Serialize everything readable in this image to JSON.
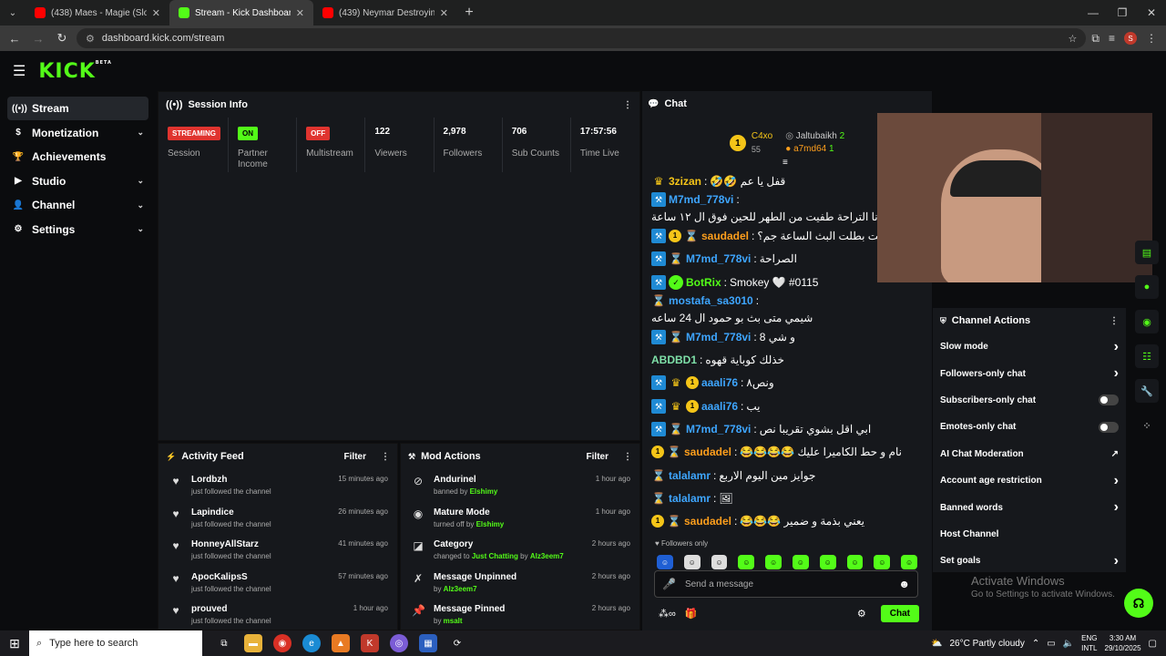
{
  "browser": {
    "tabs": [
      {
        "title": "(438) Maes - Magie (Slowed -",
        "color": "#ff0000"
      },
      {
        "title": "Stream - Kick Dashboard",
        "color": "#53fc18"
      },
      {
        "title": "(439) Neymar Destroying Baye",
        "color": "#ff0000"
      }
    ],
    "url": "dashboard.kick.com/stream",
    "profile_initial": "S"
  },
  "logo": "KICK",
  "logo_beta": "BETA",
  "sidebar": {
    "items": [
      {
        "label": "Stream",
        "icon": "radio-icon"
      },
      {
        "label": "Monetization",
        "icon": "dollar-icon"
      },
      {
        "label": "Achievements",
        "icon": "trophy-icon"
      },
      {
        "label": "Studio",
        "icon": "video-icon"
      },
      {
        "label": "Channel",
        "icon": "user-icon"
      },
      {
        "label": "Settings",
        "icon": "gear-icon"
      }
    ]
  },
  "session": {
    "title": "Session Info",
    "stats": [
      {
        "badge": "STREAMING",
        "caption": "Session"
      },
      {
        "badge": "ON",
        "caption": "Partner Income"
      },
      {
        "badge": "OFF",
        "caption": "Multistream"
      },
      {
        "num": "122",
        "caption": "Viewers"
      },
      {
        "num": "2,978",
        "caption": "Followers"
      },
      {
        "num": "706",
        "caption": "Sub Counts"
      },
      {
        "num": "17:57:56",
        "caption": "Time Live"
      }
    ]
  },
  "activity": {
    "title": "Activity Feed",
    "filter": "Filter",
    "rows": [
      {
        "name": "Lordbzh",
        "sub": "just followed the channel",
        "time": "15 minutes ago"
      },
      {
        "name": "Lapindice",
        "sub": "just followed the channel",
        "time": "26 minutes ago"
      },
      {
        "name": "HonneyAllStarz",
        "sub": "just followed the channel",
        "time": "41 minutes ago"
      },
      {
        "name": "ApocKalipsS",
        "sub": "just followed the channel",
        "time": "57 minutes ago"
      },
      {
        "name": "prouved",
        "sub": "just followed the channel",
        "time": "1 hour ago"
      }
    ]
  },
  "mod": {
    "title": "Mod Actions",
    "filter": "Filter",
    "rows": [
      {
        "name": "Andurinel",
        "pre": "banned by ",
        "by": "Elshimy",
        "time": "1 hour ago",
        "icon": "ban-icon"
      },
      {
        "name": "Mature Mode",
        "pre": "turned off by ",
        "by": "Elshimy",
        "time": "1 hour ago",
        "icon": "eye-icon"
      },
      {
        "name": "Category",
        "pre": "changed to ",
        "by": "Just Chatting",
        "mid": " by ",
        "by2": "Alz3eem7",
        "time": "2 hours ago",
        "icon": "tag-icon"
      },
      {
        "name": "Message Unpinned",
        "pre": "by ",
        "by": "Alz3eem7",
        "time": "2 hours ago",
        "icon": "unpin-icon"
      },
      {
        "name": "Message Pinned",
        "pre": "by ",
        "by": "msalt",
        "time": "2 hours ago",
        "icon": "pin-icon"
      }
    ]
  },
  "chat": {
    "title": "Chat",
    "leaders": [
      {
        "name": "C4xo",
        "count": "55"
      },
      {
        "name": "Jaltubaikh",
        "count": "2"
      },
      {
        "name": "a7md64",
        "count": "1"
      }
    ],
    "messages": [
      {
        "user": "3zizan",
        "color": "#f5c518",
        "badges": [
          "crown"
        ],
        "text": "قفل يا عم 🤣🤣"
      },
      {
        "user": "M7md_778vi",
        "color": "#3ea6ff",
        "badges": [
          "mod"
        ],
        "text": "انا التراحة طفيت من الطهر للحين فوق ال ١٢ ساعة"
      },
      {
        "user": "saudadel",
        "color": "#ff9f1c",
        "badges": [
          "mod",
          "coin",
          "sub"
        ],
        "text": "انت بطلت البث الساعة جم؟"
      },
      {
        "user": "M7md_778vi",
        "color": "#3ea6ff",
        "badges": [
          "mod",
          "sub"
        ],
        "text": "الصراحة"
      },
      {
        "user": "BotRix",
        "color": "#53fc18",
        "badges": [
          "mod",
          "ver"
        ],
        "text": "Smokey 🤍 #0115"
      },
      {
        "user": "mostafa_sa3010",
        "color": "#3ea6ff",
        "badges": [
          "sub"
        ],
        "text": "شيمي متى بث بو حمود ال 24 ساعه"
      },
      {
        "user": "M7md_778vi",
        "color": "#3ea6ff",
        "badges": [
          "mod",
          "sub"
        ],
        "text": "و شي 8"
      },
      {
        "user": "ABDBD1",
        "color": "#7ee0a8",
        "badges": [],
        "text": "خذلك كوباية قهوه"
      },
      {
        "user": "aaali76",
        "color": "#3ea6ff",
        "badges": [
          "mod",
          "crown",
          "coin"
        ],
        "text": "ونص٨"
      },
      {
        "user": "aaali76",
        "color": "#3ea6ff",
        "badges": [
          "mod",
          "crown",
          "coin"
        ],
        "text": "يب"
      },
      {
        "user": "M7md_778vi",
        "color": "#3ea6ff",
        "badges": [
          "mod",
          "sub"
        ],
        "text": "ابي اقل بشوي تقريبا نص"
      },
      {
        "user": "saudadel",
        "color": "#ff9f1c",
        "badges": [
          "coin",
          "sub"
        ],
        "text": "نام و حط الكاميرا عليك 😂😂😂😂"
      },
      {
        "user": "talalamr",
        "color": "#3ea6ff",
        "badges": [
          "sub"
        ],
        "text": "جوايز مين اليوم الاربع"
      },
      {
        "user": "talalamr",
        "color": "#3ea6ff",
        "badges": [
          "sub"
        ],
        "text": "🖼"
      },
      {
        "user": "saudadel",
        "color": "#ff9f1c",
        "badges": [
          "coin",
          "sub"
        ],
        "text": "يعني بذمة و ضمير 😂😂😂"
      }
    ],
    "followers_only": "Followers only",
    "placeholder": "Send a message",
    "send": "Chat",
    "coin_label": "1"
  },
  "actions": {
    "title": "Channel Actions",
    "items": [
      {
        "label": "Slow mode",
        "ctrl": "chevron"
      },
      {
        "label": "Followers-only chat",
        "ctrl": "chevron"
      },
      {
        "label": "Subscribers-only chat",
        "ctrl": "toggle"
      },
      {
        "label": "Emotes-only chat",
        "ctrl": "toggle"
      },
      {
        "label": "AI Chat Moderation",
        "ctrl": "external"
      },
      {
        "label": "Account age restriction",
        "ctrl": "chevron"
      },
      {
        "label": "Banned words",
        "ctrl": "chevron"
      },
      {
        "label": "Host Channel",
        "ctrl": "none"
      },
      {
        "label": "Set goals",
        "ctrl": "chevron"
      }
    ]
  },
  "watermark": {
    "line1": "Activate Windows",
    "line2": "Go to Settings to activate Windows."
  },
  "taskbar": {
    "search": "Type here to search",
    "weather": "26°C  Partly cloudy",
    "lang": "ENG",
    "lang2": "INTL",
    "time": "3:30 AM",
    "date": "29/10/2025"
  },
  "colors": {
    "accent": "#53fc18"
  }
}
